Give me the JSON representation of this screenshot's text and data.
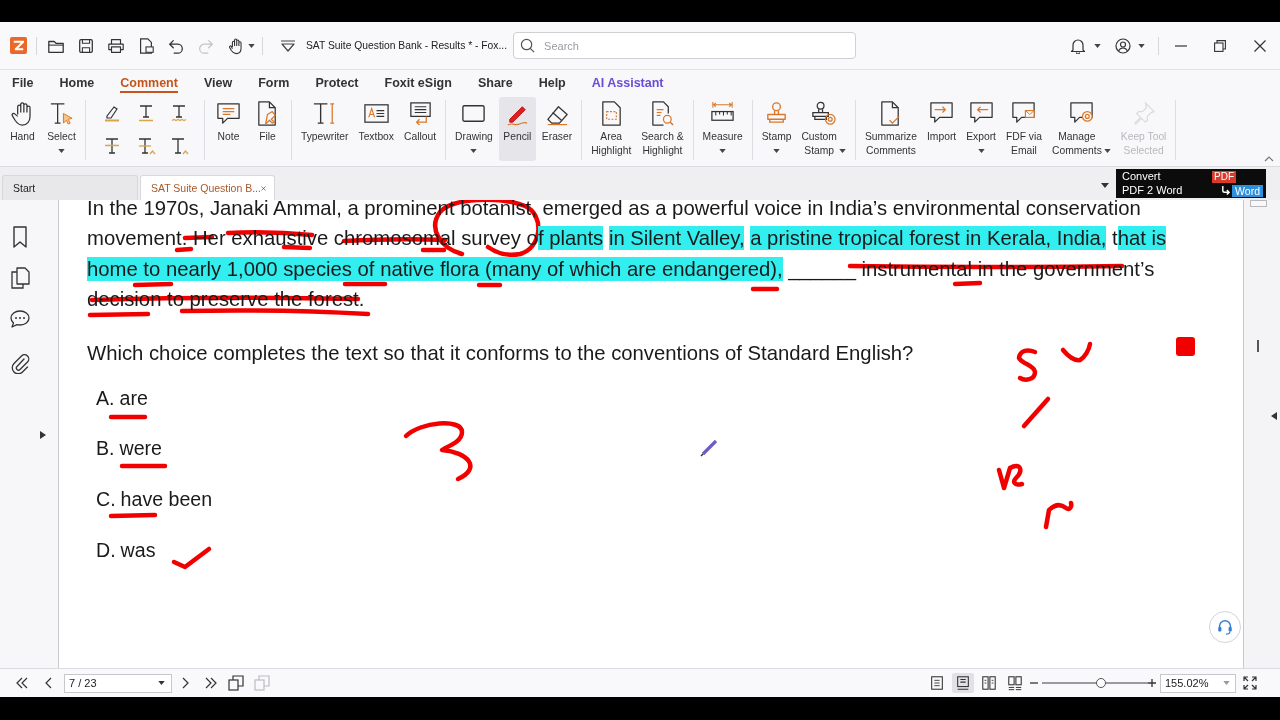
{
  "title_bar": {
    "quick_access": [
      {
        "disabled": false
      },
      {
        "disabled": false
      },
      {
        "disabled": false
      },
      {
        "disabled": false
      },
      {
        "disabled": false
      },
      {
        "disabled": true
      },
      {
        "disabled": false
      }
    ],
    "title": "SAT Suite Question Bank - Results * - Fox...",
    "search": {
      "placeholder": "Search"
    }
  },
  "menu_tabs": [
    {
      "label": "File",
      "kind": "standard",
      "selected": false
    },
    {
      "label": "Home",
      "kind": "standard",
      "selected": false
    },
    {
      "label": "Comment",
      "kind": "standard",
      "selected": true
    },
    {
      "label": "View",
      "kind": "standard",
      "selected": false
    },
    {
      "label": "Form",
      "kind": "standard",
      "selected": false
    },
    {
      "label": "Protect",
      "kind": "standard",
      "selected": false
    },
    {
      "label": "Foxit eSign",
      "kind": "standard",
      "selected": false
    },
    {
      "label": "Share",
      "kind": "standard",
      "selected": false
    },
    {
      "label": "Help",
      "kind": "standard",
      "selected": false
    },
    {
      "label": "AI Assistant",
      "kind": "assistant",
      "selected": false
    }
  ],
  "ribbon": {
    "groups": [
      {
        "items": [
          {
            "label": "Hand",
            "kind": "tool",
            "selected": false,
            "disabled": false
          },
          {
            "label": "Select",
            "kind": "dropdown",
            "selected": false,
            "disabled": false
          }
        ]
      },
      {
        "items": [
          {
            "label": "Note",
            "kind": "tool",
            "selected": false,
            "disabled": false
          },
          {
            "label": "File",
            "kind": "tool",
            "selected": false,
            "disabled": false
          }
        ]
      },
      {
        "items": [
          {
            "label": "Typewriter",
            "kind": "tool",
            "selected": false,
            "disabled": false
          },
          {
            "label": "Textbox",
            "kind": "tool",
            "selected": false,
            "disabled": false
          },
          {
            "label": "Callout",
            "kind": "tool",
            "selected": false,
            "disabled": false
          }
        ]
      },
      {
        "items": [
          {
            "label": "Drawing",
            "kind": "dropdown",
            "selected": false,
            "disabled": false
          },
          {
            "label": "Pencil",
            "kind": "tool",
            "selected": true,
            "disabled": false
          },
          {
            "label": "Eraser",
            "kind": "tool",
            "selected": false,
            "disabled": false
          }
        ]
      },
      {
        "items": [
          {
            "label": "Area\nHighlight",
            "kind": "tool",
            "selected": false,
            "disabled": false
          },
          {
            "label": "Search &\nHighlight",
            "kind": "tool",
            "selected": false,
            "disabled": false
          }
        ]
      },
      {
        "items": [
          {
            "label": "Measure",
            "kind": "dropdown",
            "selected": false,
            "disabled": false
          }
        ]
      },
      {
        "items": [
          {
            "label": "Stamp",
            "kind": "dropdown",
            "selected": false,
            "disabled": false
          },
          {
            "label": "Custom\nStamp",
            "kind": "split",
            "selected": false,
            "disabled": false
          }
        ]
      },
      {
        "items": [
          {
            "label": "Summarize\nComments",
            "kind": "tool",
            "selected": false,
            "disabled": false
          },
          {
            "label": "Import",
            "kind": "tool",
            "selected": false,
            "disabled": false
          },
          {
            "label": "Export",
            "kind": "dropdown",
            "selected": false,
            "disabled": false
          },
          {
            "label": "FDF via\nEmail",
            "kind": "tool",
            "selected": false,
            "disabled": false
          },
          {
            "label": "Manage\nComments",
            "kind": "split",
            "selected": false,
            "disabled": false
          },
          {
            "label": "Keep Tool\nSelected",
            "kind": "tool",
            "selected": false,
            "disabled": true
          }
        ]
      }
    ]
  },
  "document_tabs": [
    {
      "label": "Start",
      "selected": false,
      "closable": false
    },
    {
      "label": "SAT Suite Question B...",
      "selected": true,
      "closable": true
    }
  ],
  "promo": {
    "line_1": "Convert",
    "line_2": "PDF 2 Word",
    "badge_from": "PDF",
    "badge_to": "Word"
  },
  "document": {
    "passage": [
      {
        "text": "In the 1970s, Janaki Ammal, a prominent botanist, emerged as a powerful voice in India’s environmental conservation movement. Her exhaustive chromosomal survey o",
        "highlighted": false
      },
      {
        "text": "f plants ",
        "highlighted": true
      },
      {
        "text": "in Silent Valley, ",
        "highlighted": true
      },
      {
        "text": "a pristine tropical forest in Kerala, India,",
        "highlighted": true
      },
      {
        "text": " t",
        "highlighted": false
      },
      {
        "text": "hat is home to nearly 1,000 species of native flora (many of which are endangered),",
        "highlighted": true
      },
      {
        "text": " ______ instrumental in the government’s decision to preserve the forest.",
        "highlighted": false
      }
    ],
    "question": "Which choice completes the text so that it conforms to the conventions of Standard English?",
    "choices": [
      {
        "letter": "A.",
        "text": "are"
      },
      {
        "letter": "B.",
        "text": "were"
      },
      {
        "letter": "C.",
        "text": "have been"
      },
      {
        "letter": "D.",
        "text": "was"
      }
    ]
  },
  "status_bar": {
    "page_field": {
      "value": "7 / 23"
    },
    "page_tools": [
      {
        "disabled": false
      },
      {
        "disabled": true
      }
    ],
    "view_modes": [
      {
        "selected": false
      },
      {
        "selected": true
      },
      {
        "selected": false
      },
      {
        "selected": false
      }
    ],
    "zoom": {
      "level": 0.56,
      "value": "155.02%"
    }
  }
}
